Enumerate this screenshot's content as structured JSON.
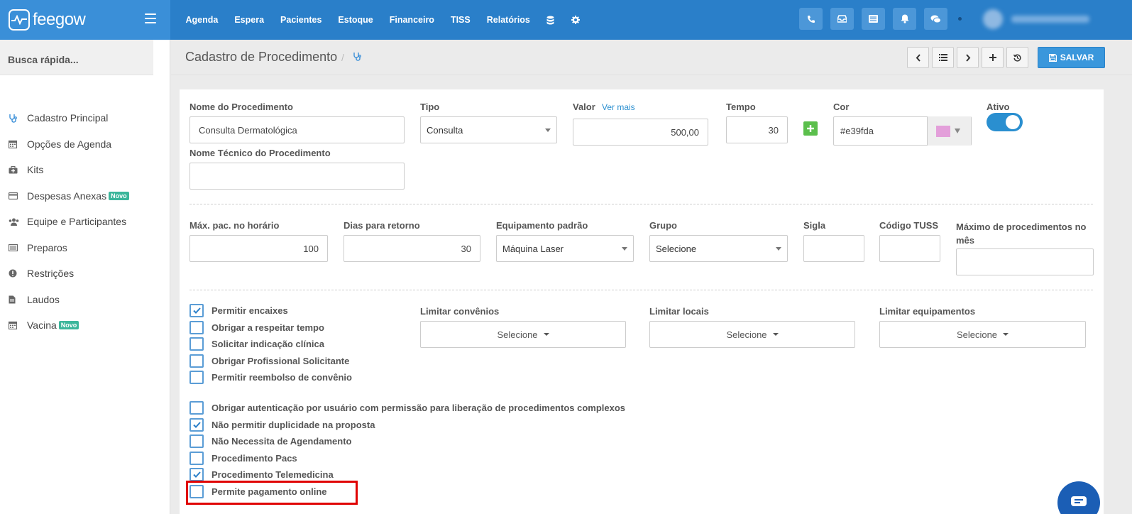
{
  "brand": {
    "name": "feegow"
  },
  "topnav": {
    "items": [
      "Agenda",
      "Espera",
      "Pacientes",
      "Estoque",
      "Financeiro",
      "TISS",
      "Relatórios"
    ]
  },
  "sidebar": {
    "quick_search": "Busca rápida...",
    "items": [
      {
        "label": "Cadastro Principal",
        "icon": "stethoscope-icon"
      },
      {
        "label": "Opções de Agenda",
        "icon": "calendar-icon"
      },
      {
        "label": "Kits",
        "icon": "medkit-icon"
      },
      {
        "label": "Despesas Anexas",
        "icon": "credit-card-icon",
        "badge": "Novo"
      },
      {
        "label": "Equipe e Participantes",
        "icon": "users-icon"
      },
      {
        "label": "Preparos",
        "icon": "list-icon"
      },
      {
        "label": "Restrições",
        "icon": "exclamation-icon"
      },
      {
        "label": "Laudos",
        "icon": "file-icon"
      },
      {
        "label": "Vacina",
        "icon": "calendar-icon",
        "badge": "Novo"
      }
    ]
  },
  "page": {
    "title": "Cadastro de Procedimento",
    "save_label": "SALVAR"
  },
  "form": {
    "nome_label": "Nome do Procedimento",
    "nome_value": "Consulta Dermatológica",
    "tipo_label": "Tipo",
    "tipo_value": "Consulta",
    "valor_label": "Valor",
    "valor_link": "Ver mais",
    "valor_value": "500,00",
    "tempo_label": "Tempo",
    "tempo_value": "30",
    "cor_label": "Cor",
    "cor_value": "#e39fda",
    "ativo_label": "Ativo",
    "nome_tecnico_label": "Nome Técnico do Procedimento",
    "max_pac_label": "Máx. pac. no horário",
    "max_pac_value": "100",
    "dias_retorno_label": "Dias para retorno",
    "dias_retorno_value": "30",
    "equipamento_label": "Equipamento padrão",
    "equipamento_value": "Máquina Laser",
    "grupo_label": "Grupo",
    "grupo_value": "Selecione",
    "sigla_label": "Sigla",
    "tuss_label": "Código TUSS",
    "max_proc_label": "Máximo de procedimentos no mês",
    "limitar_convenios_label": "Limitar convênios",
    "limitar_locais_label": "Limitar locais",
    "limitar_equipamentos_label": "Limitar equipamentos",
    "multiselect_value": "Selecione"
  },
  "checkboxes_a": [
    {
      "label": "Permitir encaixes",
      "checked": true
    },
    {
      "label": "Obrigar a respeitar tempo",
      "checked": false
    },
    {
      "label": "Solicitar indicação clínica",
      "checked": false
    },
    {
      "label": "Obrigar Profissional Solicitante",
      "checked": false
    },
    {
      "label": "Permitir reembolso de convênio",
      "checked": false
    }
  ],
  "checkboxes_b": [
    {
      "label": "Obrigar autenticação por usuário com permissão para liberação de procedimentos complexos",
      "checked": false
    },
    {
      "label": "Não permitir duplicidade na proposta",
      "checked": true
    },
    {
      "label": "Não Necessita de Agendamento",
      "checked": false
    },
    {
      "label": "Procedimento Pacs",
      "checked": false
    },
    {
      "label": "Procedimento Telemedicina",
      "checked": true
    },
    {
      "label": "Permite pagamento online",
      "checked": false
    }
  ],
  "colors": {
    "primary": "#2a7fc9",
    "accent": "#3a97dc",
    "badge": "#3bb69b",
    "highlight": "#e00000",
    "swatch": "#e39fda"
  }
}
